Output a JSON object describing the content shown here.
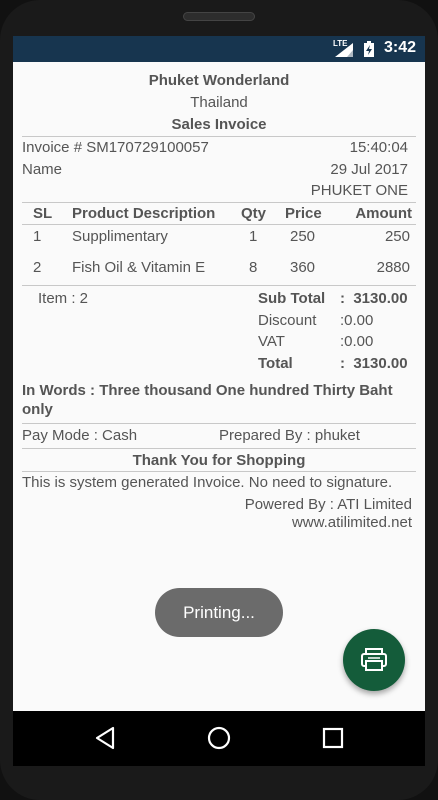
{
  "status_bar": {
    "network": "LTE",
    "time": "3:42"
  },
  "invoice": {
    "company": "Phuket Wonderland",
    "country": "Thailand",
    "doc_title": "Sales Invoice",
    "invoice_no": "Invoice # SM170729100057",
    "time": "15:40:04",
    "name_label": "Name",
    "date": "29 Jul 2017",
    "branch": "PHUKET ONE",
    "columns": [
      "SL",
      "Product Description",
      "Qty",
      "Price",
      "Amount"
    ],
    "items": [
      {
        "sl": "1",
        "description": "Supplimentary",
        "qty": "1",
        "price": "250",
        "amount": "250"
      },
      {
        "sl": "2",
        "description": "Fish Oil & Vitamin E",
        "qty": "8",
        "price": "360",
        "amount": "2880"
      }
    ],
    "item_count": "Item : 2",
    "sub_total_label": "Sub Total",
    "sub_total_value": ":  3130.00",
    "discount_label": "Discount",
    "discount_value": ":0.00",
    "vat_label": "VAT",
    "vat_value": ":0.00",
    "total_label": "Total",
    "total_value": ":  3130.00",
    "in_words_line1": "In Words : Three thousand One hundred Thirty Baht",
    "in_words_line2": "only",
    "pay_mode": "Pay Mode : Cash",
    "prepared_by": "Prepared By : phuket",
    "thank_you": "Thank You for Shopping",
    "system_note": "This is system generated Invoice. No need to signature.",
    "powered_by": "Powered By : ATI Limited",
    "website": "www.atilimited.net"
  },
  "toast": {
    "text": "Printing..."
  },
  "fab": {
    "icon": "print-icon",
    "color": "#145c3a"
  },
  "colors": {
    "status_bar": "#17354f",
    "text": "#555555"
  }
}
